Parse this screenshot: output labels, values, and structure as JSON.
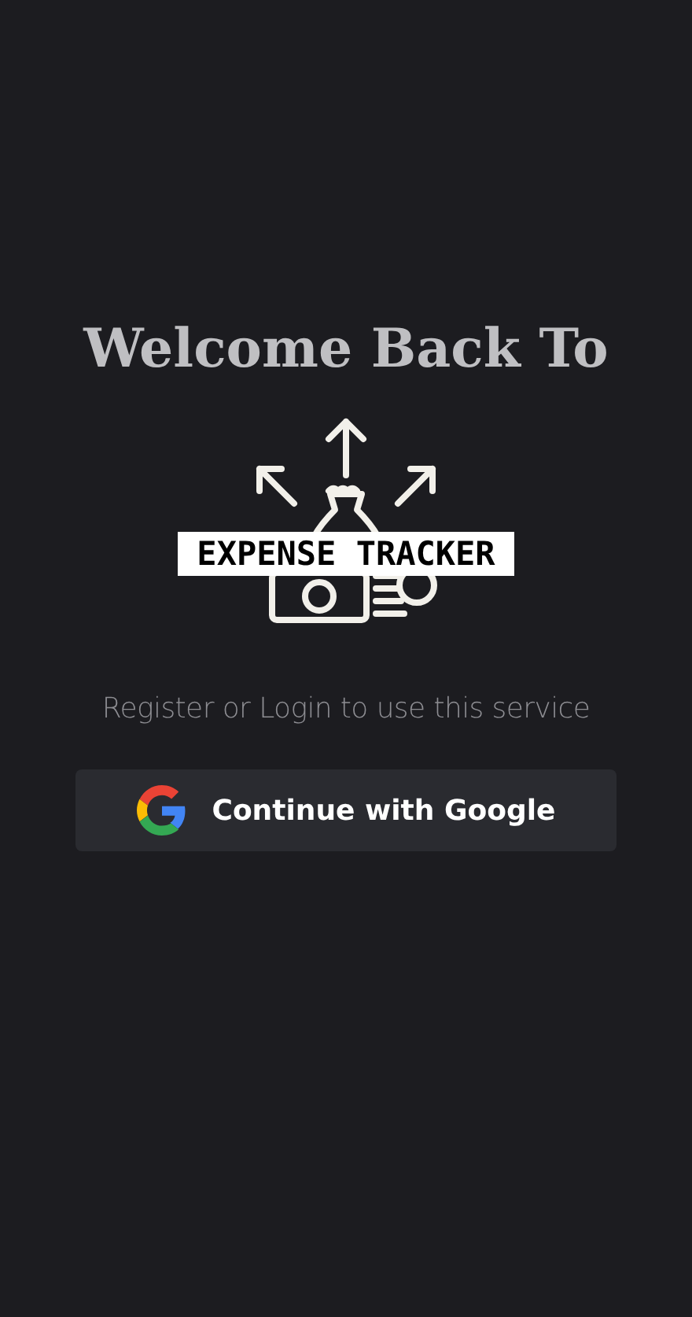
{
  "heading": "Welcome Back To",
  "logo": {
    "text": "EXPENSE TRACKER"
  },
  "subtitle": "Register or Login to use this service",
  "button": {
    "label": "Continue with Google"
  }
}
